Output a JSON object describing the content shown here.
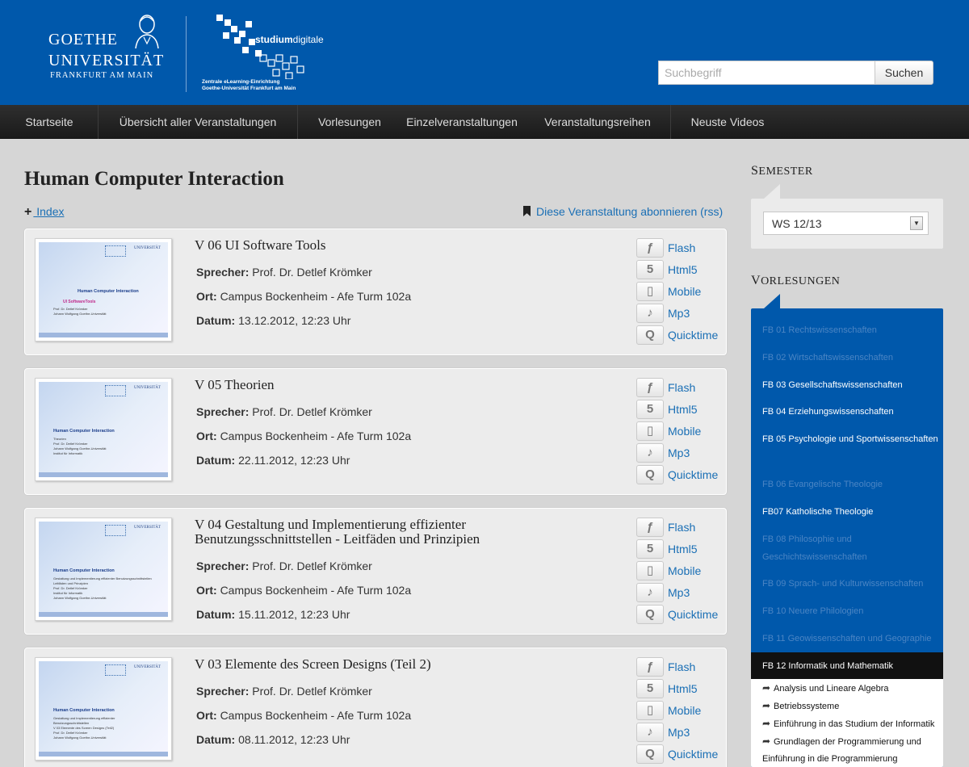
{
  "header": {
    "logo_goethe": [
      "GOETHE",
      "UNIVERSITÄT",
      "FRANKFURT AM MAIN"
    ],
    "logo_sd_name_bold": "studium",
    "logo_sd_name_regular": "digitale",
    "logo_sd_sub": [
      "Zentrale eLearning-Einrichtung",
      "Goethe-Universität Frankfurt am Main"
    ],
    "search_placeholder": "Suchbegriff",
    "search_button": "Suchen"
  },
  "nav": [
    "Startseite",
    "Übersicht aller Veranstaltungen",
    "Vorlesungen",
    "Einzelveranstaltungen",
    "Veranstaltungsreihen",
    "Neuste Videos"
  ],
  "main": {
    "title": "Human Computer Interaction",
    "index_label": " Index",
    "rss_label": "Diese Veranstaltung abonnieren (rss)"
  },
  "labels": {
    "speaker": "Sprecher:",
    "location": "Ort:",
    "date": "Datum:"
  },
  "media_formats": [
    "Flash",
    "Html5",
    "Mobile",
    "Mp3",
    "Quicktime"
  ],
  "lectures": [
    {
      "title": "V 06 UI Software Tools",
      "speaker": "Prof. Dr. Detlef Krömker",
      "location": "Campus Bockenheim - Afe Turm 102a",
      "date": "13.12.2012, 12:23 Uhr",
      "slide_title": "Human Computer Interaction",
      "slide_sub": "UI SoftwareTools",
      "slide_lines": [
        "Prof. Dr. Detlef Krömker",
        "Johann Wolfgang Goethe-Universität"
      ]
    },
    {
      "title": "V 05 Theorien",
      "speaker": "Prof. Dr. Detlef Krömker",
      "location": "Campus Bockenheim - Afe Turm 102a",
      "date": "22.11.2012, 12:23 Uhr",
      "slide_title": "Human Computer Interaction",
      "slide_sub": "",
      "slide_lines": [
        "Theorien",
        "Prof. Dr. Detlef Krömker",
        "Johann Wolfgang Goethe-Universität",
        "Institut für Informatik"
      ]
    },
    {
      "title": "V 04 Gestaltung und Implementierung effizienter Benutzungsschnittstellen - Leitfäden und Prinzipien",
      "speaker": "Prof. Dr. Detlef Krömker",
      "location": "Campus Bockenheim - Afe Turm 102a",
      "date": "15.11.2012, 12:23 Uhr",
      "slide_title": "Human Computer Interaction",
      "slide_sub": "",
      "slide_lines": [
        "Gestaltung und Implementierung effizienter Benutzungsschnittstellen",
        "Leitfäden und Prinzipien",
        "Prof. Dr. Detlef Krömker",
        "Institut für Informatik",
        "Johann Wolfgang Goethe-Universität"
      ]
    },
    {
      "title": "V 03 Elemente des Screen Designs (Teil 2)",
      "speaker": "Prof. Dr. Detlef Krömker",
      "location": "Campus Bockenheim - Afe Turm 102a",
      "date": "08.11.2012, 12:23 Uhr",
      "slide_title": "Human Computer Interaction",
      "slide_sub": "",
      "slide_lines": [
        "Gestaltung und Implementierung effizienter",
        "Benutzungsschnittstellen",
        "V 03 Elemente des Screen Designs (Teil2)",
        "Prof. Dr. Detlef Krömker",
        "Johann Wolfgang Goethe-Universität"
      ]
    }
  ],
  "sidebar": {
    "semester_heading": "Semester",
    "semester_value": "WS 12/13",
    "lectures_heading": "Vorlesungen",
    "departments": [
      {
        "label": "FB 01 Rechtswissenschaften",
        "active": false
      },
      {
        "label": "FB 02 Wirtschaftswissenschaften",
        "active": false
      },
      {
        "label": "FB 03 Gesellschaftswissenschaften",
        "active": true
      },
      {
        "label": "FB 04 Erziehungswissenschaften",
        "active": true
      },
      {
        "label": "FB 05 Psychologie und Sportwissenschaften",
        "active": true
      },
      {
        "label": "FB 06 Evangelische Theologie",
        "active": false
      },
      {
        "label": "FB07 Katholische Theologie",
        "active": true
      },
      {
        "label": "FB 08 Philosophie und Geschichtswissenschaften",
        "active": false
      },
      {
        "label": "FB 09 Sprach- und Kulturwissenschaften",
        "active": false
      },
      {
        "label": "FB 10 Neuere Philologien",
        "active": false
      },
      {
        "label": "FB 11 Geowissenschaften und Geographie",
        "active": false
      }
    ],
    "selected_department": "FB 12 Informatik und Mathematik",
    "sub_items": [
      "Analysis und Lineare Algebra",
      "Betriebssysteme",
      "Einführung in das Studium der Informatik",
      "Grundlagen der Programmierung und",
      "Einführung in die Programmierung"
    ]
  },
  "colors": {
    "header_blue": "#0058ab",
    "link_blue": "#1a6fb5",
    "nav_dark": "#222222",
    "bg_gray": "#d6d6d6"
  }
}
